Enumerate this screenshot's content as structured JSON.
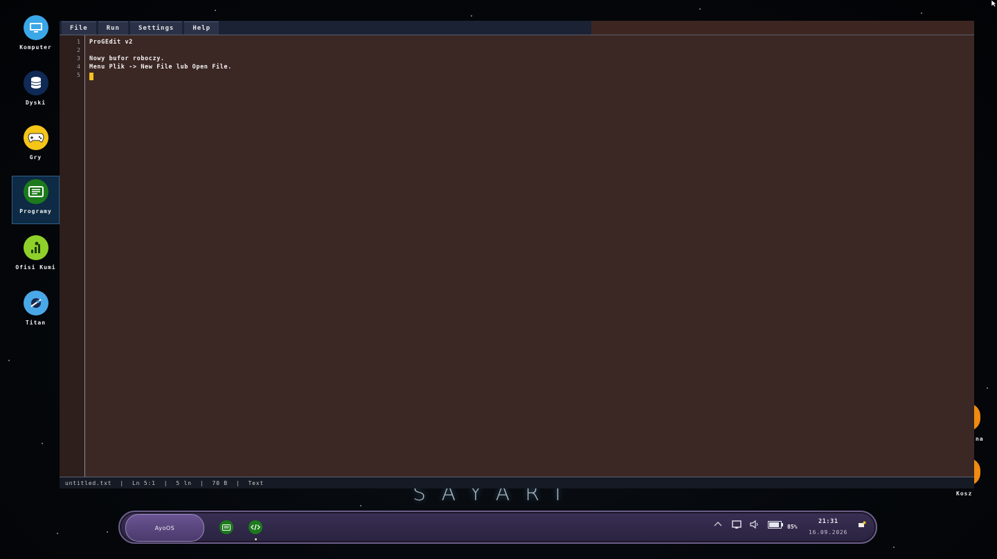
{
  "desktop": {
    "icons": [
      {
        "label": "Komputer",
        "icon": "computer-icon",
        "color": "#3aa7e8"
      },
      {
        "label": "Dyski",
        "icon": "database-icon",
        "color": "#0f2a55"
      },
      {
        "label": "Gry",
        "icon": "gamepad-icon",
        "color": "#f5c518"
      },
      {
        "label": "Programy",
        "icon": "programs-icon",
        "color": "#1c7a1c"
      },
      {
        "label": "Ofisi Kumi",
        "icon": "office-icon",
        "color": "#8fd12a"
      },
      {
        "label": "Titan",
        "icon": "titan-icon",
        "color": "#4aa8e8"
      }
    ],
    "right_icons": [
      {
        "label": "na",
        "icon": "partial-icon"
      },
      {
        "label": "Kosz",
        "icon": "trash-icon"
      }
    ],
    "watermark": "SAYARI"
  },
  "editor": {
    "menu": [
      "File",
      "Run",
      "Settings",
      "Help"
    ],
    "lines": [
      "ProGEdit v2",
      "",
      "Nowy bufor roboczy.",
      "Menu Plik -> New File lub Open File.",
      ""
    ],
    "line_numbers": [
      "1",
      "2",
      "3",
      "4",
      "5"
    ],
    "status": {
      "filename": "untitled.txt",
      "position": "Ln 5:1",
      "line_count": "5 ln",
      "size": "70 B",
      "mode": "Text"
    },
    "colors": {
      "background": "#3b2724",
      "cursor": "#f2c21a"
    }
  },
  "taskbar": {
    "start_label": "AyoOS",
    "apps": [
      {
        "icon": "programs-icon",
        "color": "#1c7a1c"
      },
      {
        "icon": "code-icon",
        "color": "#1c7a1c"
      }
    ],
    "battery": "85%",
    "time": "21:31",
    "date": "16.09.2026"
  }
}
